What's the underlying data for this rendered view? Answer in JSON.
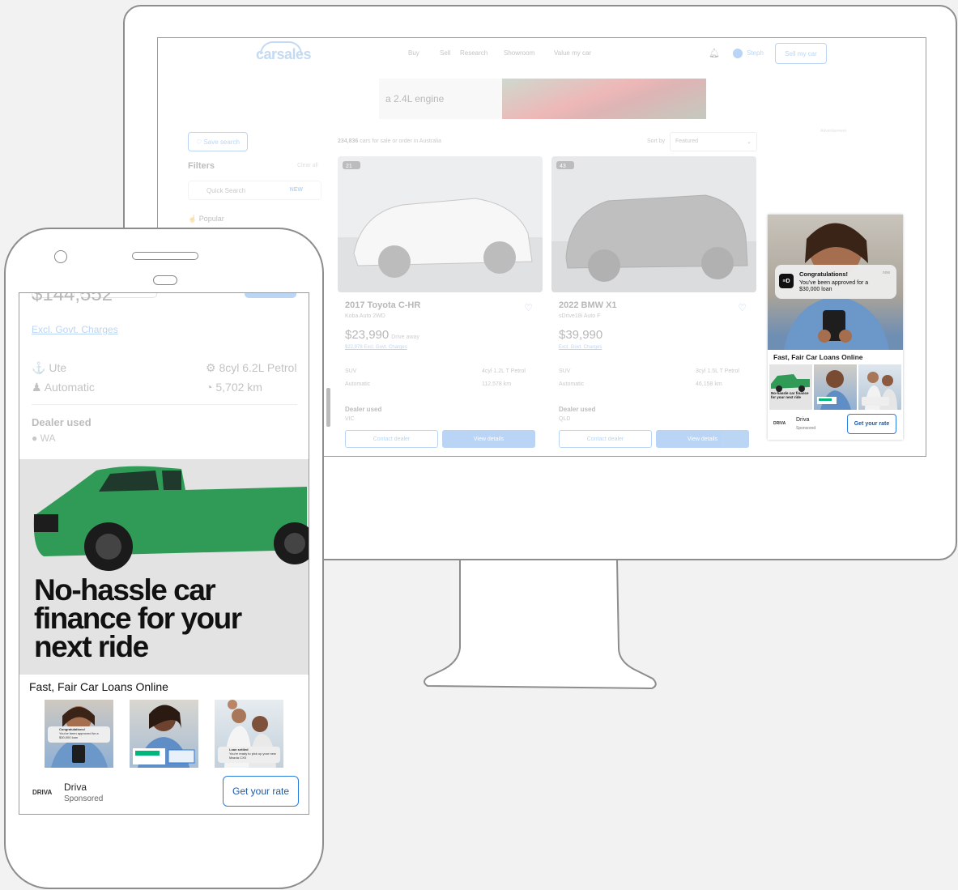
{
  "desktop": {
    "logo": "carsales",
    "nav": [
      "Buy",
      "Sell",
      "Research",
      "Showroom",
      "Value my car"
    ],
    "user_name": "Steph",
    "sell_button": "Sell my car",
    "banner_text": "a 2.4L engine",
    "save_search": "Save search",
    "filters_title": "Filters",
    "clear_all": "Clear all",
    "quick_search": "Quick Search",
    "quick_search_badge": "NEW",
    "popular": "Popular",
    "results_count": "234,836",
    "results_text": "cars for sale or order in Australia",
    "sort_label": "Sort by",
    "sort_value": "Featured",
    "advertisement_label": "Advertisement",
    "listings": [
      {
        "photo_count": "21",
        "title": "2017 Toyota C-HR",
        "subtitle": "Koba Auto 2WD",
        "price": "$23,990",
        "price_note": "Drive away",
        "excl": "$22,978 Excl. Govt. Charges",
        "body": "SUV",
        "engine": "4cyl 1.2L T Petrol",
        "transmission": "Automatic",
        "odometer": "112,578 km",
        "seller": "Dealer used",
        "state": "VIC",
        "contact": "Contact dealer",
        "view": "View details"
      },
      {
        "photo_count": "43",
        "title": "2022 BMW X1",
        "subtitle": "sDrive18i Auto F",
        "price": "$39,990",
        "price_note": "",
        "excl": "Excl. Govt. Charges",
        "body": "SUV",
        "engine": "3cyl 1.5L T Petrol",
        "transmission": "Automatic",
        "odometer": "46,158 km",
        "seller": "Dealer used",
        "state": "QLD",
        "contact": "Contact dealer",
        "view": "View details"
      }
    ],
    "ad": {
      "notif_title": "Congratulations!",
      "notif_time": "now",
      "notif_body": "You've been approved for a $30,000 loan",
      "title": "Fast, Fair Car Loans Online",
      "thumb_text": "No-hassle car finance for your next ride",
      "brand_logo": "DRIVA",
      "brand": "Driva",
      "sponsored": "Sponsored",
      "cta": "Get your rate"
    }
  },
  "phone": {
    "price": "$144,552",
    "excl": "Excl. Govt. Charges",
    "body": "Ute",
    "engine": "8cyl 6.2L Petrol",
    "transmission": "Automatic",
    "odometer": "5,702 km",
    "seller": "Dealer used",
    "state": "WA",
    "ad": {
      "headline": "No-hassle car finance for your next ride",
      "title": "Fast, Fair Car Loans Online",
      "thumb1_title": "Congratulations!",
      "thumb1_text": "You've been approved for a $30,000 loan",
      "thumb3_title": "Loan settled",
      "thumb3_text": "You're ready to pick up your new Mazda CX5",
      "brand_logo": "DRIVA",
      "brand": "Driva",
      "sponsored": "Sponsored",
      "cta": "Get your rate"
    }
  },
  "colors": {
    "accent": "#2a7de1",
    "ad_green": "#2f9b57",
    "background": "#f2f2f2"
  }
}
